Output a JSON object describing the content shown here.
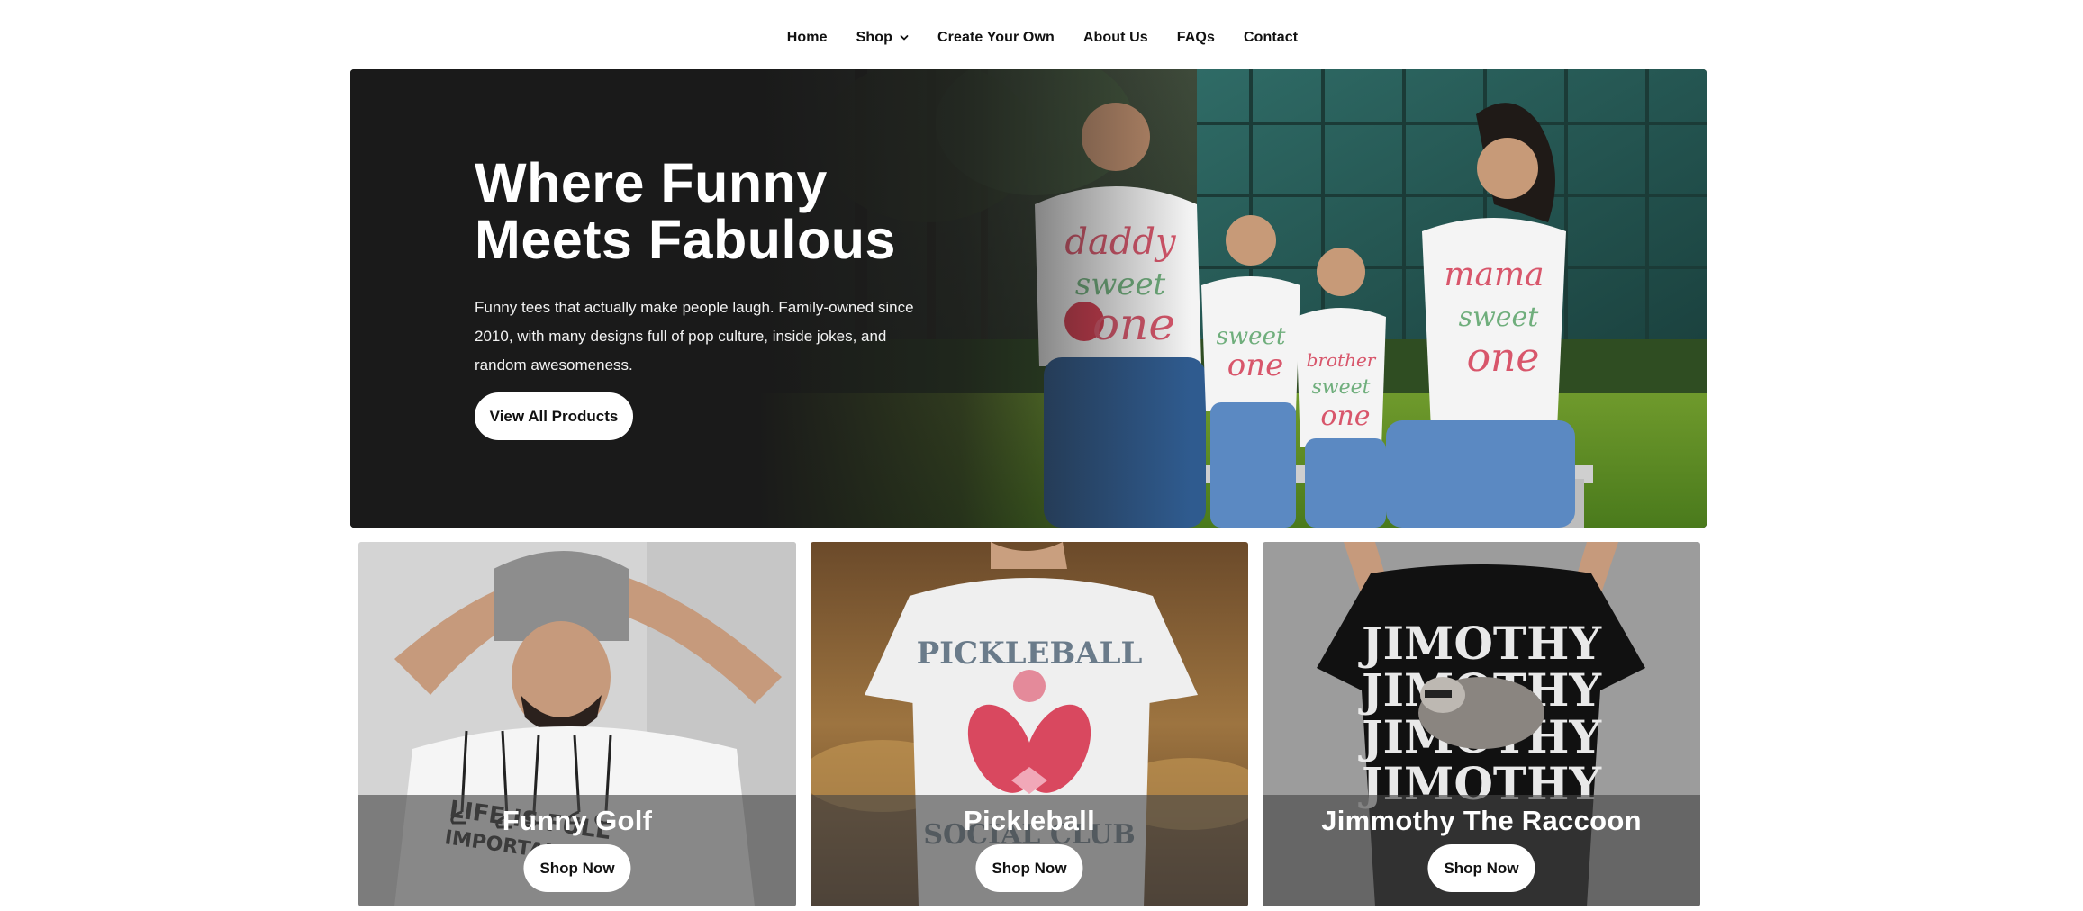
{
  "nav": {
    "items": [
      {
        "label": "Home"
      },
      {
        "label": "Shop",
        "has_dropdown": true,
        "icon": "chevron-down-icon"
      },
      {
        "label": "Create Your Own"
      },
      {
        "label": "About Us"
      },
      {
        "label": "FAQs"
      },
      {
        "label": "Contact"
      }
    ]
  },
  "hero": {
    "title": "Where Funny Meets Fabulous",
    "description": "Funny tees that actually make people laugh. Family-owned since 2010, with many designs full of pop culture, inside jokes, and random awesomeness.",
    "button_label": "View All Products",
    "image": "family-in-matching-tees-photo",
    "shirt_texts": [
      "daddy of the sweet one",
      "sweet one",
      "brother of the sweet one",
      "mama of the sweet one"
    ]
  },
  "categories": [
    {
      "title": "Funny Golf",
      "button_label": "Shop Now",
      "image": "man-in-beanie-golf-tee-photo",
      "shirt_text": "LIFE IS FULL IMPORTANT"
    },
    {
      "title": "Pickleball",
      "button_label": "Shop Now",
      "image": "woman-in-pickleball-tee-photo",
      "shirt_text": "PICKLEBALL SOCIAL CLUB"
    },
    {
      "title": "Jimmothy The Raccoon",
      "button_label": "Shop Now",
      "image": "black-raccoon-tee-photo",
      "shirt_text": "JIMOTHY JIMOTHY JIMOTHY JIMOTHY"
    }
  ],
  "colors": {
    "hero_bg": "#1a1a1a",
    "button_bg": "#ffffff",
    "overlay": "#464646",
    "text_dark": "#111111"
  }
}
